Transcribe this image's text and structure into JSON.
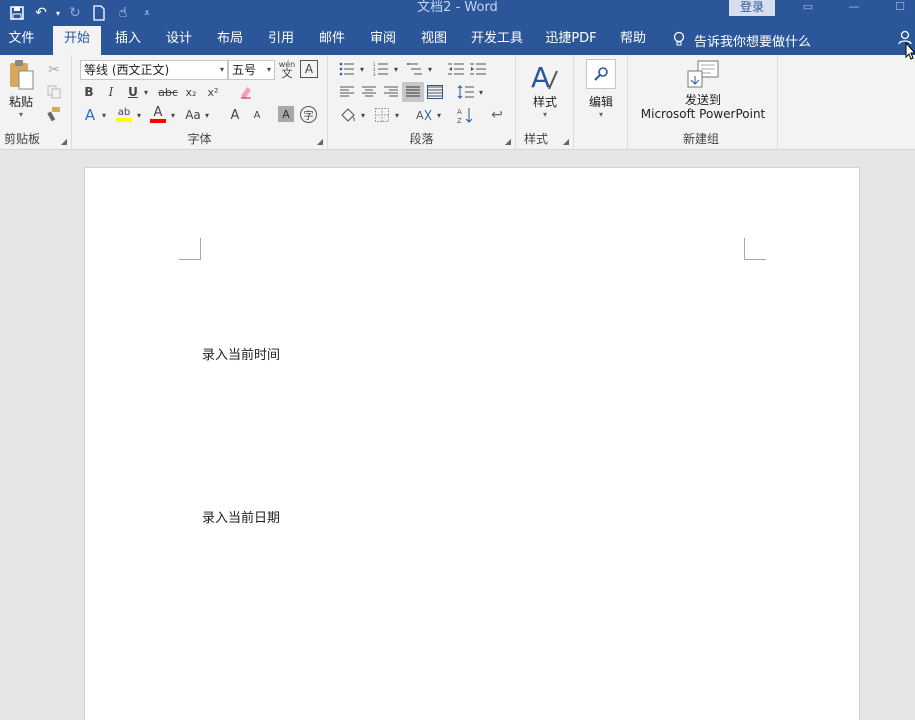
{
  "window": {
    "title": "文档2  -  Word",
    "signin_label": "登录"
  },
  "tabs": [
    {
      "label": "文件"
    },
    {
      "label": "开始"
    },
    {
      "label": "插入"
    },
    {
      "label": "设计"
    },
    {
      "label": "布局"
    },
    {
      "label": "引用"
    },
    {
      "label": "邮件"
    },
    {
      "label": "审阅"
    },
    {
      "label": "视图"
    },
    {
      "label": "开发工具"
    },
    {
      "label": "迅捷PDF"
    },
    {
      "label": "帮助"
    }
  ],
  "tell_me": "告诉我你想要做什么",
  "ribbon": {
    "clipboard": {
      "label": "剪贴板",
      "paste": "粘贴"
    },
    "font": {
      "label": "字体",
      "font_name": "等线 (西文正文)",
      "font_size": "五号",
      "bold": "B",
      "italic": "I",
      "underline": "U",
      "strike": "abc",
      "subscript": "x₂",
      "superscript": "x²",
      "change_case": "Aa",
      "grow": "A",
      "shrink": "A"
    },
    "paragraph": {
      "label": "段落"
    },
    "styles": {
      "label": "样式",
      "button": "样式"
    },
    "editing": {
      "button": "编辑"
    },
    "newgroup": {
      "label": "新建组",
      "send_line1": "发送到",
      "send_line2": "Microsoft PowerPoint"
    }
  },
  "document": {
    "line1": "录入当前时间",
    "line2": "录入当前日期"
  },
  "colors": {
    "accent": "#2b579a",
    "highlight": "#ffff00",
    "font_color": "#ff0000"
  }
}
